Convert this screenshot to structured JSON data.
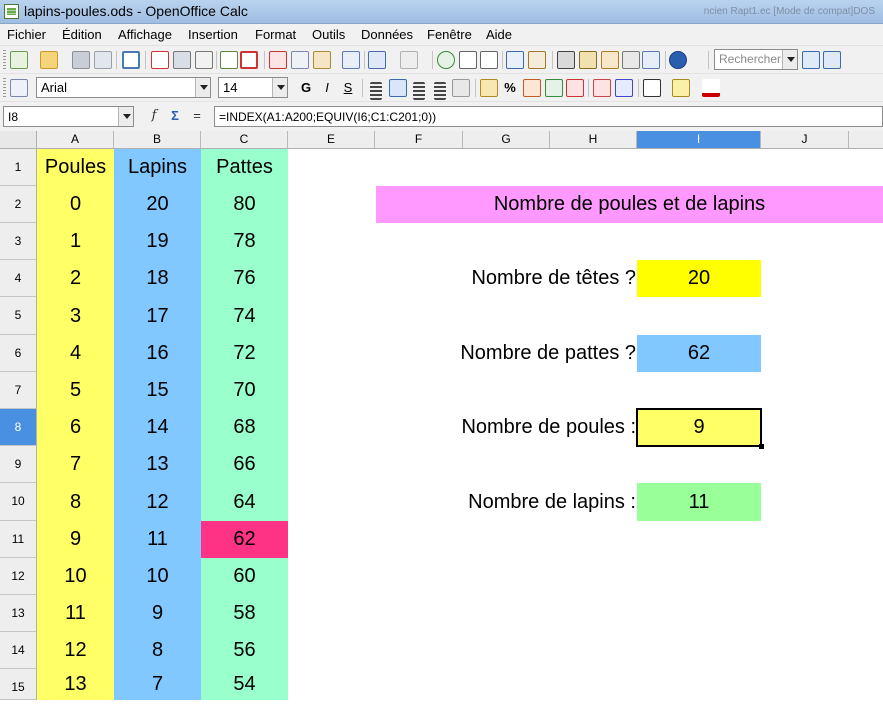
{
  "window": {
    "title": "lapins-poules.ods - OpenOffice Calc",
    "blurred_title": "ncien Rapt1.ec [Mode de compat]DOS"
  },
  "menu": [
    "Fichier",
    "Édition",
    "Affichage",
    "Insertion",
    "Format",
    "Outils",
    "Données",
    "Fenêtre",
    "Aide"
  ],
  "toolbar": {
    "search_placeholder": "Rechercher",
    "font_name": "Arial",
    "font_size": "14",
    "bold": "G",
    "italic": "I",
    "underline": "S",
    "percent": "%"
  },
  "formula_bar": {
    "name_box": "I8",
    "fx": "f",
    "sigma": "Σ",
    "equals": "=",
    "formula": "=INDEX(A1:A200;EQUIV(I6;C1:C201;0))"
  },
  "columns": [
    "A",
    "B",
    "C",
    "E",
    "F",
    "G",
    "H",
    "I",
    "J"
  ],
  "active_column": "I",
  "rows": [
    "1",
    "2",
    "3",
    "4",
    "5",
    "6",
    "7",
    "8",
    "9",
    "10",
    "11",
    "12",
    "13",
    "14",
    "15"
  ],
  "active_row": "8",
  "table": {
    "headers": [
      "Poules",
      "Lapins",
      "Pattes"
    ],
    "poules": [
      "0",
      "1",
      "2",
      "3",
      "4",
      "5",
      "6",
      "7",
      "8",
      "9",
      "10",
      "11",
      "12",
      "13"
    ],
    "lapins": [
      "20",
      "19",
      "18",
      "17",
      "16",
      "15",
      "14",
      "13",
      "12",
      "11",
      "10",
      "9",
      "8",
      "7"
    ],
    "pattes": [
      "80",
      "78",
      "76",
      "74",
      "72",
      "70",
      "68",
      "66",
      "64",
      "62",
      "60",
      "58",
      "56",
      "54"
    ],
    "highlighted_pattes": "62"
  },
  "panel": {
    "title": "Nombre de poules et de lapins",
    "tetes_label": "Nombre de têtes ?",
    "tetes_value": "20",
    "pattes_label": "Nombre de pattes ?",
    "pattes_value": "62",
    "poules_label": "Nombre de poules :",
    "poules_value": "9",
    "lapins_label": "Nombre de lapins :",
    "lapins_value": "11"
  },
  "colors": {
    "poules_column": "#ffff66",
    "lapins_column": "#80c8ff",
    "pattes_column": "#99ffcc",
    "highlight": "#ff3385",
    "title_band": "#ff99ff",
    "tetes_box": "#ffff00",
    "pattes_box": "#80c8ff",
    "poules_box": "#ffff66",
    "lapins_box": "#99ff99"
  }
}
